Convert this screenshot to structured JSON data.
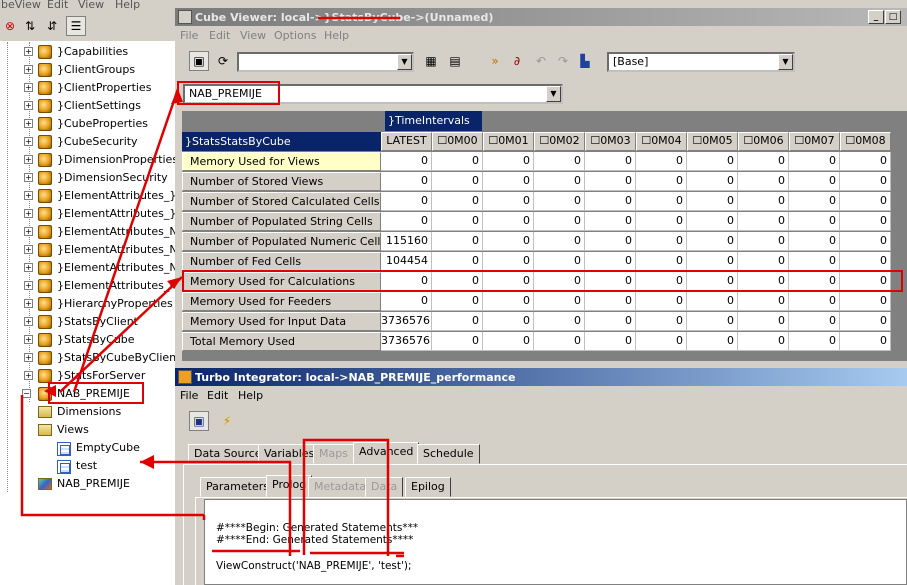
{
  "background_app": {
    "menu": [
      "ibeView",
      "Edit",
      "View",
      "Help"
    ],
    "tree_items": [
      {
        "label": "}Capabilities"
      },
      {
        "label": "}ClientGroups"
      },
      {
        "label": "}ClientProperties"
      },
      {
        "label": "}ClientSettings"
      },
      {
        "label": "}CubeProperties"
      },
      {
        "label": "}CubeSecurity"
      },
      {
        "label": "}DimensionProperties"
      },
      {
        "label": "}DimensionSecurity"
      },
      {
        "label": "}ElementAttributes_}Cli"
      },
      {
        "label": "}ElementAttributes_}Gro"
      },
      {
        "label": "}ElementAttributes_NAB"
      },
      {
        "label": "}ElementAttributes_NAB"
      },
      {
        "label": "}ElementAttributes_NAB"
      },
      {
        "label": "}ElementAttributes_NAB"
      },
      {
        "label": "}HierarchyProperties"
      },
      {
        "label": "}StatsByClient"
      },
      {
        "label": "}StatsByCube"
      },
      {
        "label": "}StatsByCubeByClient"
      },
      {
        "label": "}StatsForServer"
      },
      {
        "label": "NAB_PREMIJE"
      }
    ],
    "subtree": {
      "dimensions": "Dimensions",
      "views": "Views",
      "view_items": [
        "EmptyCube",
        "test"
      ],
      "dimension_item": "NAB_PREMIJE"
    }
  },
  "cube_viewer": {
    "title_prefix": "Cube Viewer: local->",
    "title_cube": "}StatsByCube->",
    "title_suffix": "(Unnamed)",
    "menu": [
      "File",
      "Edit",
      "View",
      "Options",
      "Help"
    ],
    "view_combo_value": "",
    "base_combo_value": "[Base]",
    "title_dimension_value": "NAB_PREMIJE",
    "column_dimension": "}TimeIntervals",
    "row_dimension": "}StatsStatsByCube",
    "columns": [
      "LATEST",
      "0M00",
      "0M01",
      "0M02",
      "0M03",
      "0M04",
      "0M05",
      "0M06",
      "0M07",
      "0M08"
    ],
    "rows": [
      {
        "label": "Memory Used for Views",
        "values": [
          "0",
          "0",
          "0",
          "0",
          "0",
          "0",
          "0",
          "0",
          "0",
          "0"
        ]
      },
      {
        "label": "Number of Stored Views",
        "values": [
          "0",
          "0",
          "0",
          "0",
          "0",
          "0",
          "0",
          "0",
          "0",
          "0"
        ]
      },
      {
        "label": "Number of Stored Calculated Cells",
        "values": [
          "0",
          "0",
          "0",
          "0",
          "0",
          "0",
          "0",
          "0",
          "0",
          "0"
        ]
      },
      {
        "label": "Number of Populated String Cells",
        "values": [
          "0",
          "0",
          "0",
          "0",
          "0",
          "0",
          "0",
          "0",
          "0",
          "0"
        ]
      },
      {
        "label": "Number of Populated Numeric Cells",
        "values": [
          "115160",
          "0",
          "0",
          "0",
          "0",
          "0",
          "0",
          "0",
          "0",
          "0"
        ]
      },
      {
        "label": "Number of Fed Cells",
        "values": [
          "104454",
          "0",
          "0",
          "0",
          "0",
          "0",
          "0",
          "0",
          "0",
          "0"
        ]
      },
      {
        "label": "Memory Used for Calculations",
        "values": [
          "0",
          "0",
          "0",
          "0",
          "0",
          "0",
          "0",
          "0",
          "0",
          "0"
        ]
      },
      {
        "label": "Memory Used for Feeders",
        "values": [
          "0",
          "0",
          "0",
          "0",
          "0",
          "0",
          "0",
          "0",
          "0",
          "0"
        ]
      },
      {
        "label": "Memory Used for Input Data",
        "values": [
          "3736576",
          "0",
          "0",
          "0",
          "0",
          "0",
          "0",
          "0",
          "0",
          "0"
        ]
      },
      {
        "label": "Total Memory Used",
        "values": [
          "3736576",
          "0",
          "0",
          "0",
          "0",
          "0",
          "0",
          "0",
          "0",
          "0"
        ]
      }
    ]
  },
  "turbo_integrator": {
    "title": "Turbo Integrator:  local->NAB_PREMIJE_performance",
    "menu": [
      "File",
      "Edit",
      "Help"
    ],
    "main_tabs": [
      "Data Source",
      "Variables",
      "Maps",
      "Advanced",
      "Schedule"
    ],
    "sub_tabs": [
      "Parameters",
      "Prolog",
      "Metadata",
      "Data",
      "Epilog"
    ],
    "code_lines": [
      "#****Begin: Generated Statements***",
      "#****End: Generated Statements****",
      "",
      "ViewConstruct('NAB_PREMIJE', 'test');"
    ]
  },
  "colors": {
    "annotation_red": "#e00000",
    "active_title": "#0a246a",
    "selected_row": "#ffffc8"
  }
}
